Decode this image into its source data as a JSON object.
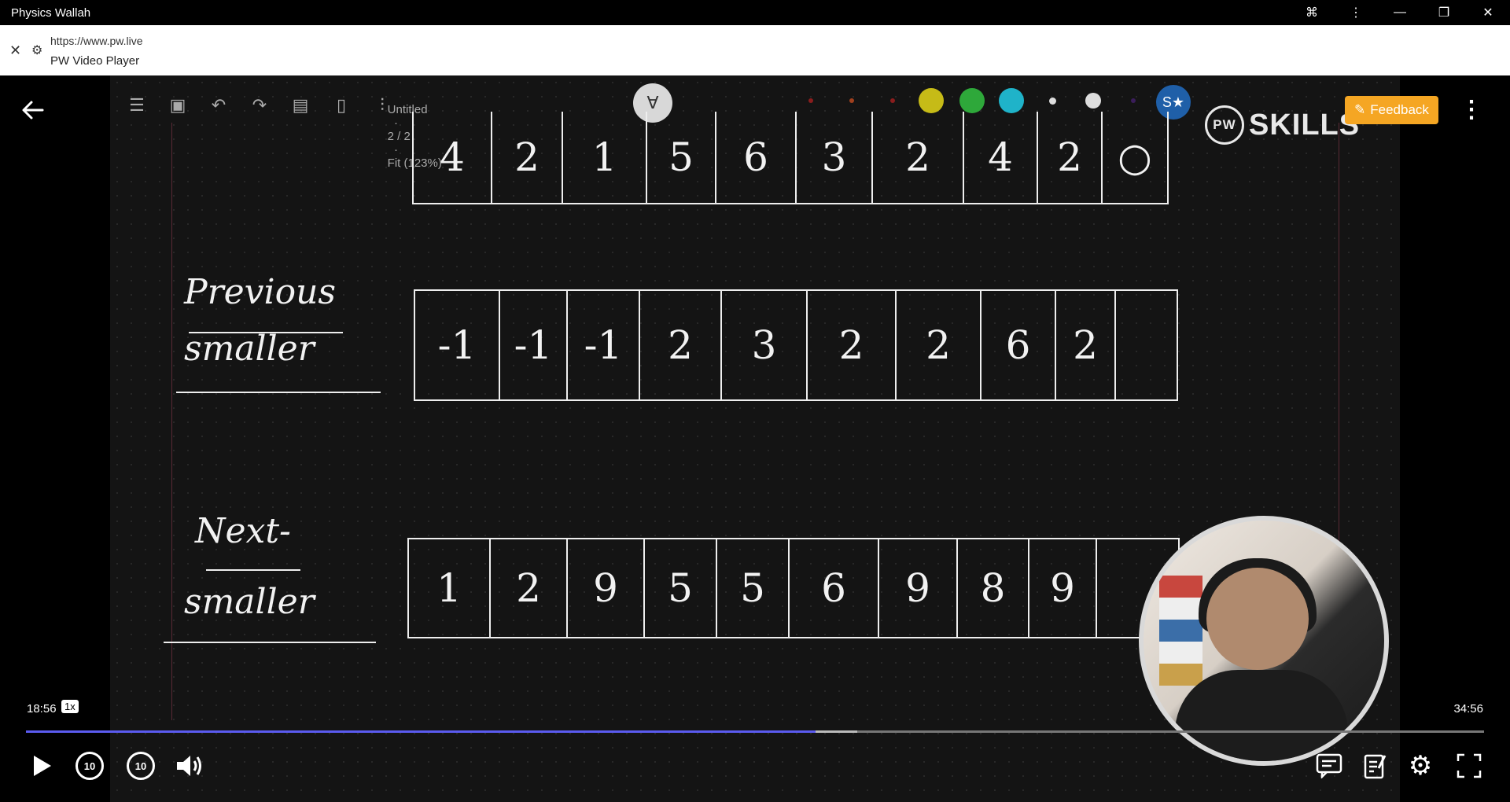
{
  "window": {
    "title": "Physics Wallah"
  },
  "address": {
    "url": "https://www.pw.live",
    "page_name": "PW Video Player"
  },
  "whiteboard": {
    "doc_title": "Untitled",
    "page": "2 / 2",
    "zoom": "Fit (123%)",
    "title_separator": "·"
  },
  "overlay": {
    "feedback_label": "Feedback",
    "logo_text": "SKILLS",
    "logo_badge": "PW"
  },
  "board": {
    "top_row": [
      "4",
      "2",
      "1",
      "5",
      "6",
      "3",
      "2",
      "4",
      "2",
      "○"
    ],
    "previous_smaller": {
      "label_line1": "Previous",
      "label_line2": "smaller",
      "values": [
        "-1",
        "-1",
        "-1",
        "2",
        "3",
        "2",
        "2",
        "6",
        "2",
        ""
      ]
    },
    "next_smaller": {
      "label_line1": "Next",
      "label_line2": "smaller",
      "values": [
        "1",
        "2",
        "9",
        "5",
        "5",
        "6",
        "9",
        "8",
        "9",
        ""
      ]
    }
  },
  "player": {
    "current_time": "18:56",
    "speed": "1x",
    "duration": "34:56",
    "progress_fraction": 0.5413,
    "buffered_fraction": 0.57,
    "skip_back": "10",
    "skip_forward": "10"
  },
  "colors": {
    "accent": "#5b5bf0",
    "feedback": "#f5a623",
    "swatch_yellow": "#c6bb17",
    "swatch_green": "#2ea83a",
    "swatch_cyan": "#1fb3c9"
  }
}
